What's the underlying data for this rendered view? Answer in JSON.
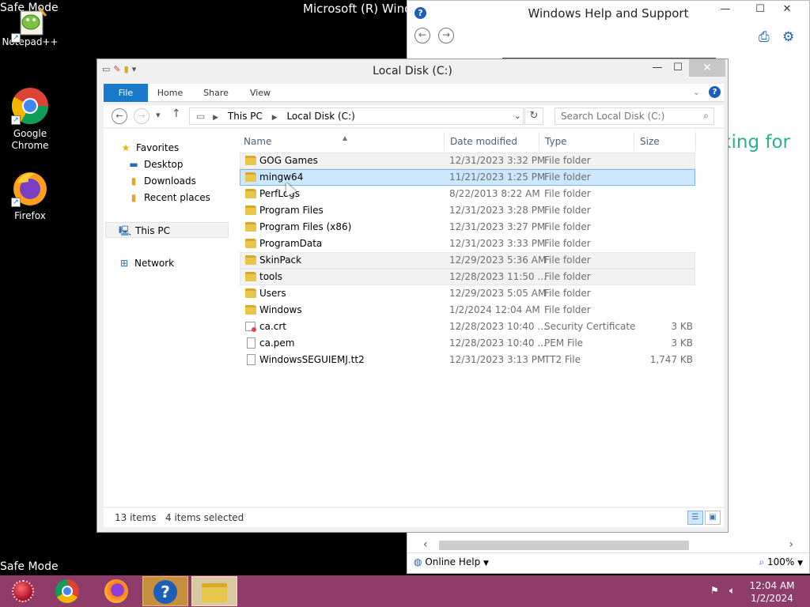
{
  "desktop": {
    "safe_mode_top": "Safe Mode",
    "safe_mode_bottom": "Safe Mode",
    "os_title": "Microsoft (R) Windows",
    "icons": [
      {
        "label": "Notepad++"
      },
      {
        "label": "Google Chrome"
      },
      {
        "label": "Firefox"
      }
    ]
  },
  "help_window": {
    "title": "Windows Help and Support",
    "content_snippet": "oking for",
    "online_help": "Online Help",
    "zoom": "100%"
  },
  "explorer": {
    "title": "Local Disk (C:)",
    "ribbon_tabs": [
      "File",
      "Home",
      "Share",
      "View"
    ],
    "breadcrumb": [
      "This PC",
      "Local Disk (C:)"
    ],
    "search_placeholder": "Search Local Disk (C:)",
    "nav": {
      "favorites": "Favorites",
      "desktop": "Desktop",
      "downloads": "Downloads",
      "recent": "Recent places",
      "this_pc": "This PC",
      "network": "Network"
    },
    "columns": {
      "name": "Name",
      "date": "Date modified",
      "type": "Type",
      "size": "Size"
    },
    "files": [
      {
        "name": "GOG Games",
        "date": "12/31/2023 3:32 PM",
        "type": "File folder",
        "size": "",
        "kind": "folder",
        "state": "selected"
      },
      {
        "name": "mingw64",
        "date": "11/21/2023 1:25 PM",
        "type": "File folder",
        "size": "",
        "kind": "folder",
        "state": "focused"
      },
      {
        "name": "PerfLogs",
        "date": "8/22/2013 8:22 AM",
        "type": "File folder",
        "size": "",
        "kind": "folder",
        "state": ""
      },
      {
        "name": "Program Files",
        "date": "12/31/2023 3:28 PM",
        "type": "File folder",
        "size": "",
        "kind": "folder",
        "state": ""
      },
      {
        "name": "Program Files (x86)",
        "date": "12/31/2023 3:27 PM",
        "type": "File folder",
        "size": "",
        "kind": "folder",
        "state": ""
      },
      {
        "name": "ProgramData",
        "date": "12/31/2023 3:33 PM",
        "type": "File folder",
        "size": "",
        "kind": "folder",
        "state": ""
      },
      {
        "name": "SkinPack",
        "date": "12/29/2023 5:36 AM",
        "type": "File folder",
        "size": "",
        "kind": "folder",
        "state": "selected"
      },
      {
        "name": "tools",
        "date": "12/28/2023 11:50 ...",
        "type": "File folder",
        "size": "",
        "kind": "folder",
        "state": "selected"
      },
      {
        "name": "Users",
        "date": "12/29/2023 5:05 AM",
        "type": "File folder",
        "size": "",
        "kind": "folder",
        "state": ""
      },
      {
        "name": "Windows",
        "date": "1/2/2024 12:04 AM",
        "type": "File folder",
        "size": "",
        "kind": "folder",
        "state": ""
      },
      {
        "name": "ca.crt",
        "date": "12/28/2023 10:40 ...",
        "type": "Security Certificate",
        "size": "3 KB",
        "kind": "cert",
        "state": ""
      },
      {
        "name": "ca.pem",
        "date": "12/28/2023 10:40 ...",
        "type": "PEM File",
        "size": "3 KB",
        "kind": "file",
        "state": ""
      },
      {
        "name": "WindowsSEGUIEMJ.tt2",
        "date": "12/31/2023 3:13 PM",
        "type": "TT2 File",
        "size": "1,747 KB",
        "kind": "file",
        "state": ""
      }
    ],
    "status": {
      "items": "13 items",
      "selected": "4 items selected"
    }
  },
  "taskbar": {
    "time": "12:04 AM",
    "date": "1/2/2024"
  },
  "colors": {
    "taskbar": "#8e3d6a",
    "file_tab": "#1979ca",
    "selection": "#cce8ff",
    "accent_green": "#2bb08a"
  }
}
